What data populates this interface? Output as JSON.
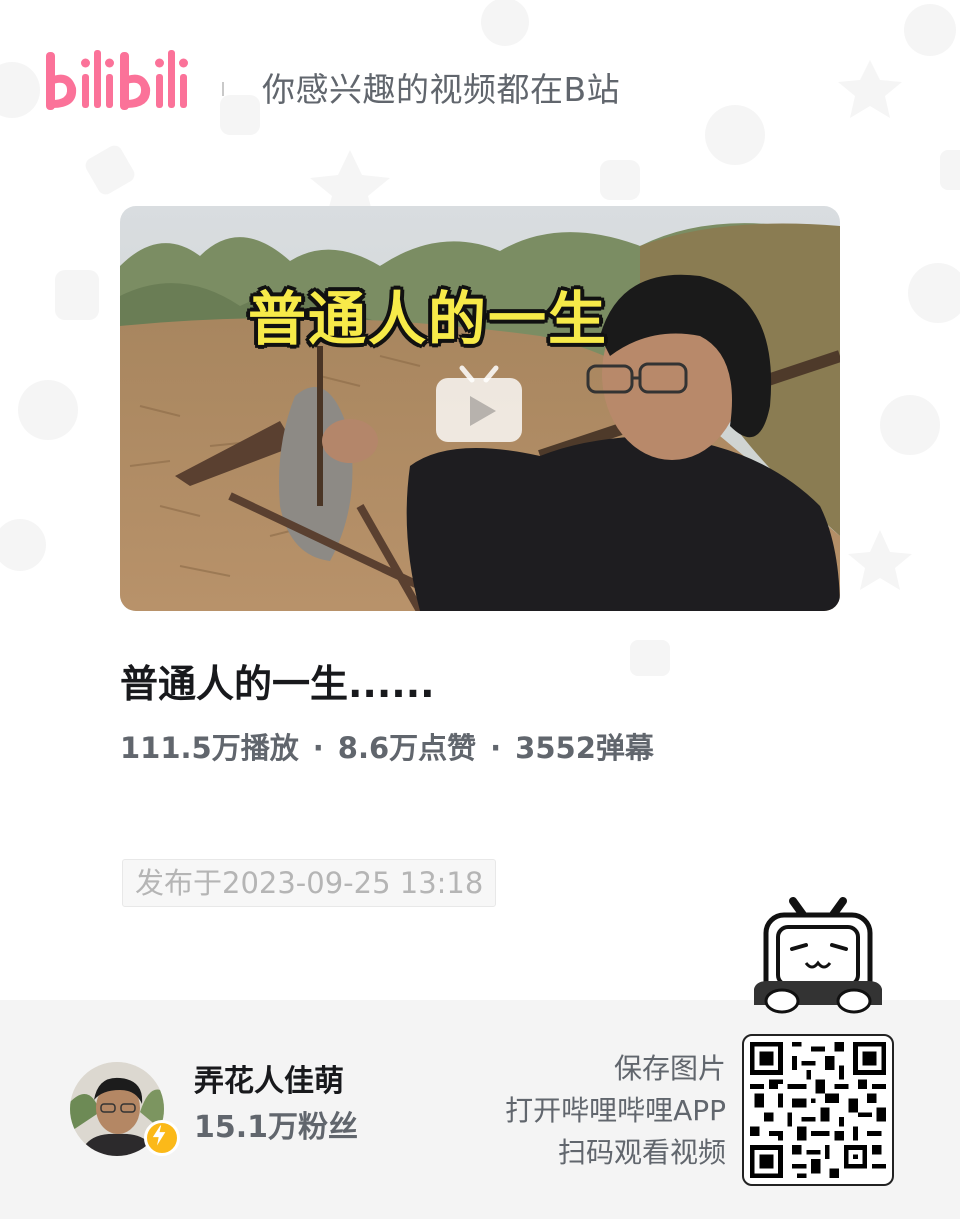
{
  "header": {
    "logo_text": "bilibili",
    "tagline": "你感兴趣的视频都在B站"
  },
  "video": {
    "thumbnail_caption": "普通人的一生",
    "title": "普通人的一生......",
    "views": "111.5万播放",
    "likes": "8.6万点赞",
    "danmaku": "3552弹幕",
    "separator": "·",
    "published": "发布于2023-09-25 13:18"
  },
  "uploader": {
    "name": "弄花人佳萌",
    "fans": "15.1万粉丝"
  },
  "cta": {
    "line1": "保存图片",
    "line2": "打开哔哩哔哩APP",
    "line3": "扫码观看视频"
  },
  "colors": {
    "brand_pink": "#fb7299",
    "thumb_caption": "#f7ea49",
    "badge": "#fbb919",
    "footer_bg": "#f4f4f4"
  },
  "icons": [
    "bilibili-logo",
    "play-icon",
    "tv-mascot-icon",
    "verified-lightning-icon",
    "qr-code"
  ]
}
